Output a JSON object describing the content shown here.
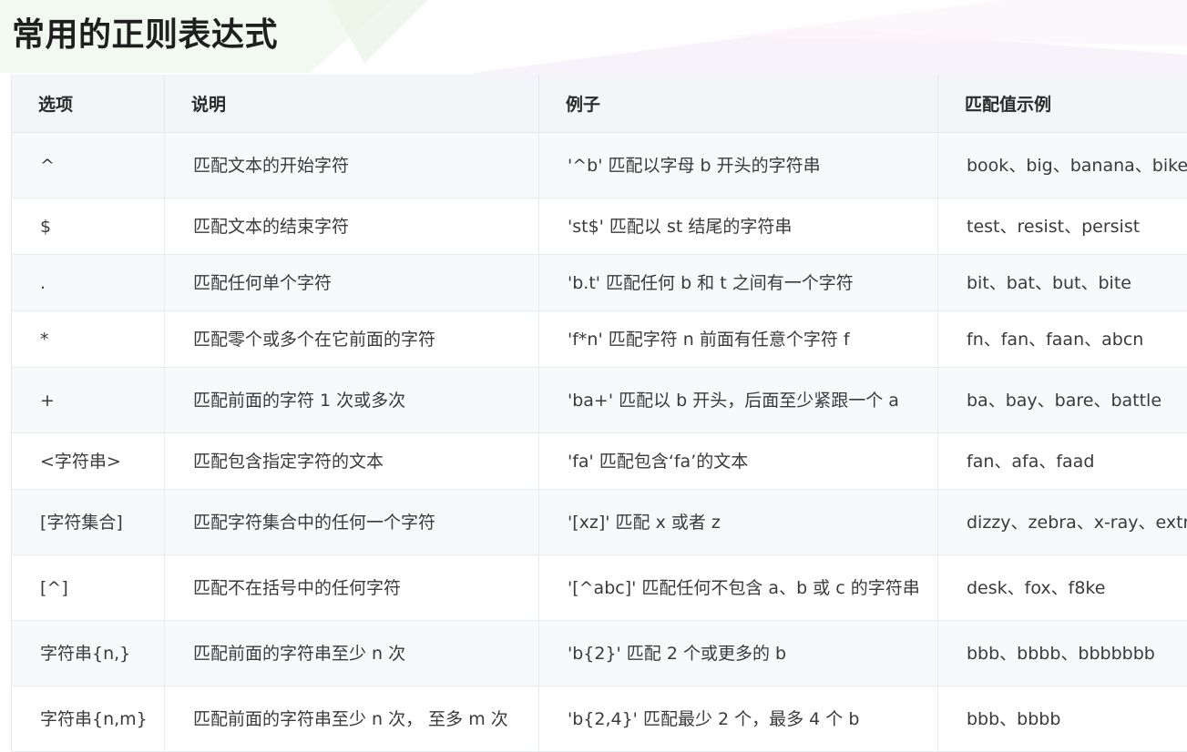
{
  "page": {
    "title": "常用的正则表达式"
  },
  "table": {
    "headers": [
      "选项",
      "说明",
      "例子",
      "匹配值示例"
    ],
    "rows": [
      {
        "option": "^",
        "desc": "匹配文本的开始字符",
        "example": "'^b' 匹配以字母 b 开头的字符串",
        "match": "book、big、banana、bike"
      },
      {
        "option": "$",
        "desc": "匹配文本的结束字符",
        "example": "'st$' 匹配以 st 结尾的字符串",
        "match": "test、resist、persist"
      },
      {
        "option": ".",
        "desc": "匹配任何单个字符",
        "example": "'b.t' 匹配任何 b 和 t 之间有一个字符",
        "match": "bit、bat、but、bite"
      },
      {
        "option": "*",
        "desc": "匹配零个或多个在它前面的字符",
        "example": "'f*n' 匹配字符 n 前面有任意个字符 f",
        "match": "fn、fan、faan、abcn"
      },
      {
        "option": "+",
        "desc": "匹配前面的字符 1 次或多次",
        "example": "'ba+' 匹配以 b 开头，后面至少紧跟一个 a",
        "match": "ba、bay、bare、battle"
      },
      {
        "option": "<字符串>",
        "desc": "匹配包含指定字符的文本",
        "example": "'fa' 匹配包含‘fa’的文本",
        "match": "fan、afa、faad"
      },
      {
        "option": "[字符集合]",
        "desc": "匹配字符集合中的任何一个字符",
        "example": "'[xz]' 匹配 x 或者 z",
        "match": "dizzy、zebra、x-ray、extra"
      },
      {
        "option": "[^]",
        "desc": "匹配不在括号中的任何字符",
        "example": "'[^abc]' 匹配任何不包含 a、b 或 c 的字符串",
        "match": "desk、fox、f8ke"
      },
      {
        "option": "字符串{n,}",
        "desc": "匹配前面的字符串至少 n 次",
        "example": "'b{2}' 匹配 2 个或更多的 b",
        "match": "bbb、bbbb、bbbbbbb"
      },
      {
        "option": "字符串{n,m}",
        "desc": "匹配前面的字符串至少 n 次， 至多 m 次",
        "example": "'b{2,4}' 匹配最少 2 个，最多 4 个 b",
        "match": "bbb、bbbb"
      }
    ]
  }
}
